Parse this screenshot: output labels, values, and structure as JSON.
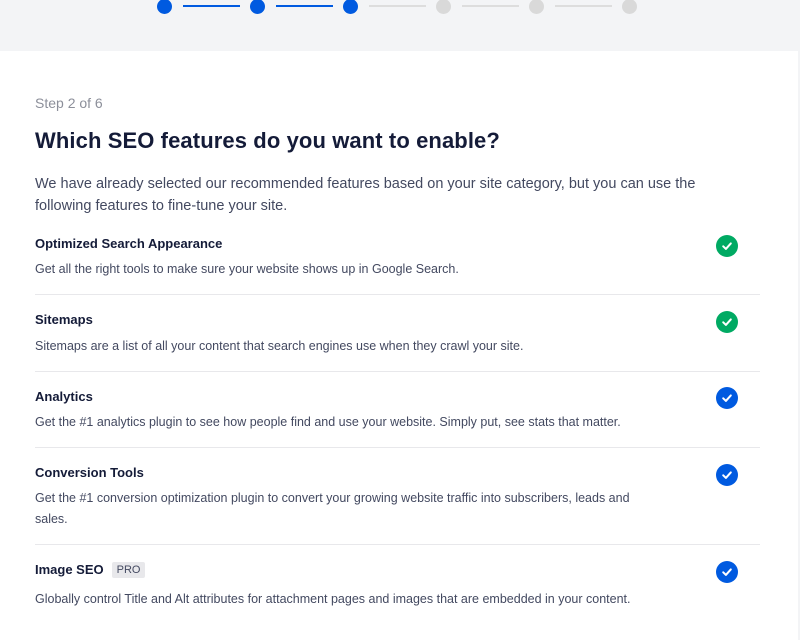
{
  "wizard": {
    "steps_total": 6,
    "current_step": 3,
    "step_label": "Step 2 of 6",
    "title": "Which SEO features do you want to enable?",
    "description": "We have already selected our recommended features based on your site category, but you can use the following features to fine-tune your site."
  },
  "colors": {
    "accent": "#005ae0",
    "success": "#00aa63",
    "text": "#141b38",
    "muted": "#434960"
  },
  "features": [
    {
      "name": "Optimized Search Appearance",
      "description": "Get all the right tools to make sure your website shows up in Google Search.",
      "checked": true,
      "check_style": "green",
      "badge": ""
    },
    {
      "name": "Sitemaps",
      "description": "Sitemaps are a list of all your content that search engines use when they crawl your site.",
      "checked": true,
      "check_style": "green",
      "badge": ""
    },
    {
      "name": "Analytics",
      "description": "Get the #1 analytics plugin to see how people find and use your website. Simply put, see stats that matter.",
      "checked": true,
      "check_style": "blue",
      "badge": ""
    },
    {
      "name": "Conversion Tools",
      "description": "Get the #1 conversion optimization plugin to convert your growing website traffic into subscribers, leads and sales.",
      "checked": true,
      "check_style": "blue",
      "badge": ""
    },
    {
      "name": "Image SEO",
      "description": "Globally control Title and Alt attributes for attachment pages and images that are embedded in your content.",
      "checked": true,
      "check_style": "blue",
      "badge": "PRO"
    }
  ]
}
